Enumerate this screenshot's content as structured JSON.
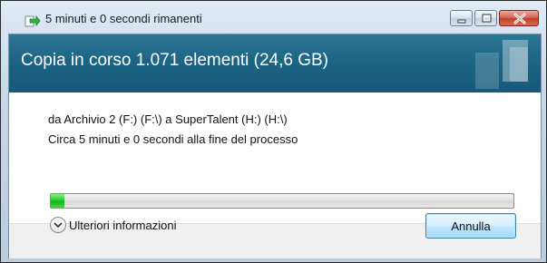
{
  "window": {
    "title": "5 minuti e 0 secondi rimanenti",
    "icon": "copy-progress-icon"
  },
  "header": {
    "title": "Copia in corso 1.071 elementi (24,6 GB)"
  },
  "details": {
    "route": "da Archivio 2 (F:) (F:\\) a SuperTalent (H:) (H:\\)",
    "eta": "Circa 5 minuti e 0 secondi alla fine del processo"
  },
  "progress": {
    "fraction": 0.03,
    "color": "#22c022"
  },
  "footer": {
    "more_info_label": "Ulteriori informazioni",
    "cancel_label": "Annulla"
  }
}
